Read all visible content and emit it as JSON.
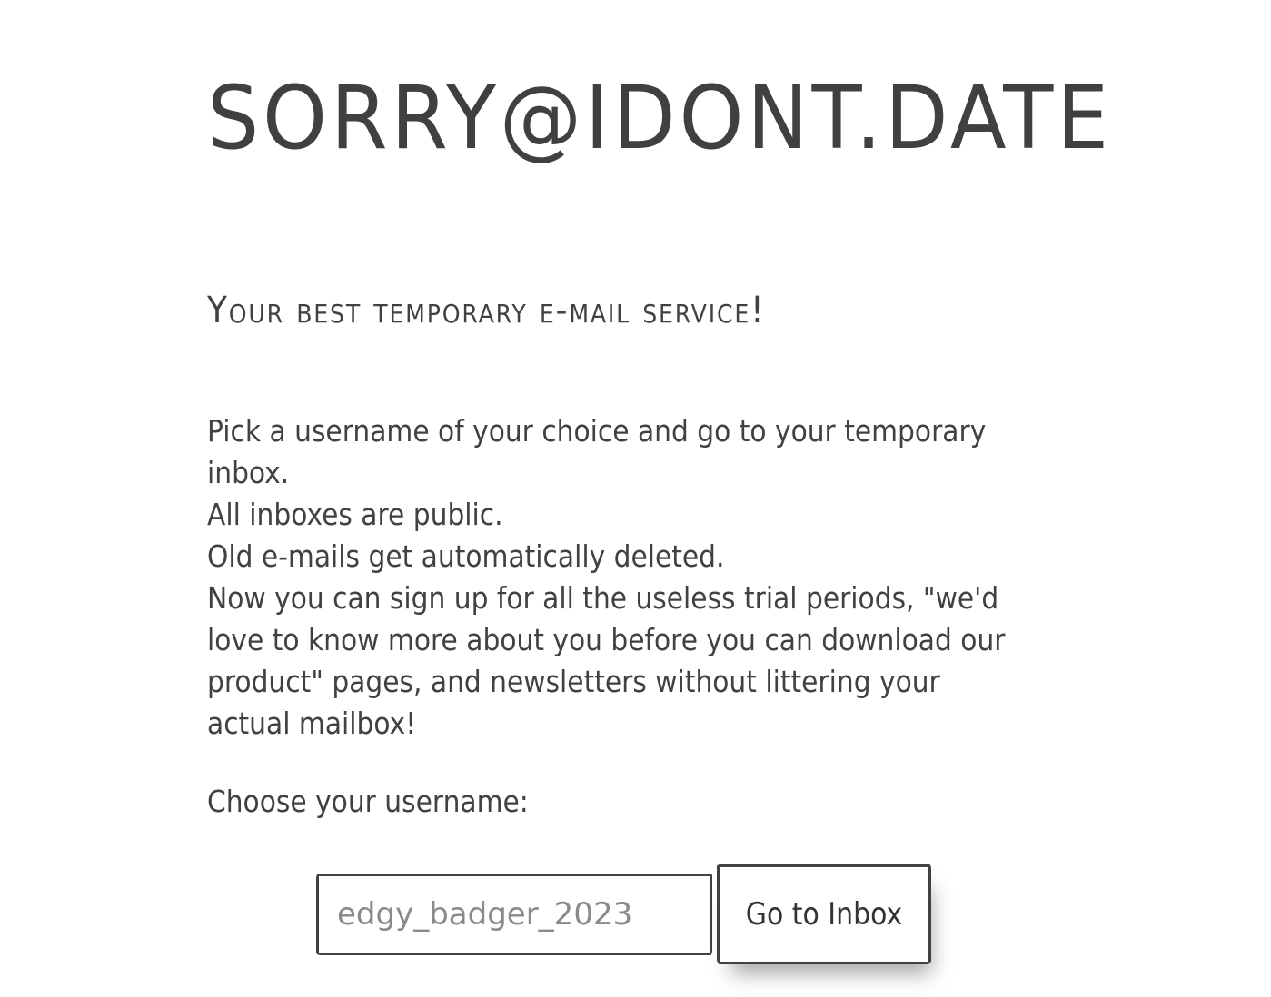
{
  "header": {
    "site_title": "SORRY@IDONT.DATE"
  },
  "main": {
    "tagline": "Your best temporary e-mail service!",
    "intro": {
      "line1": "Pick a username of your choice and go to your temporary inbox.",
      "line2": "All inboxes are public.",
      "line3": "Old e-mails get automatically deleted.",
      "line4": "Now you can sign up for all the useless trial periods, \"we'd love to know more about you before you can download our product\" pages, and newsletters without littering your actual mailbox!"
    },
    "choose_label": "Choose your username:"
  },
  "form": {
    "username_placeholder": "edgy_badger_2023",
    "username_value": "",
    "submit_label": "Go to Inbox"
  }
}
